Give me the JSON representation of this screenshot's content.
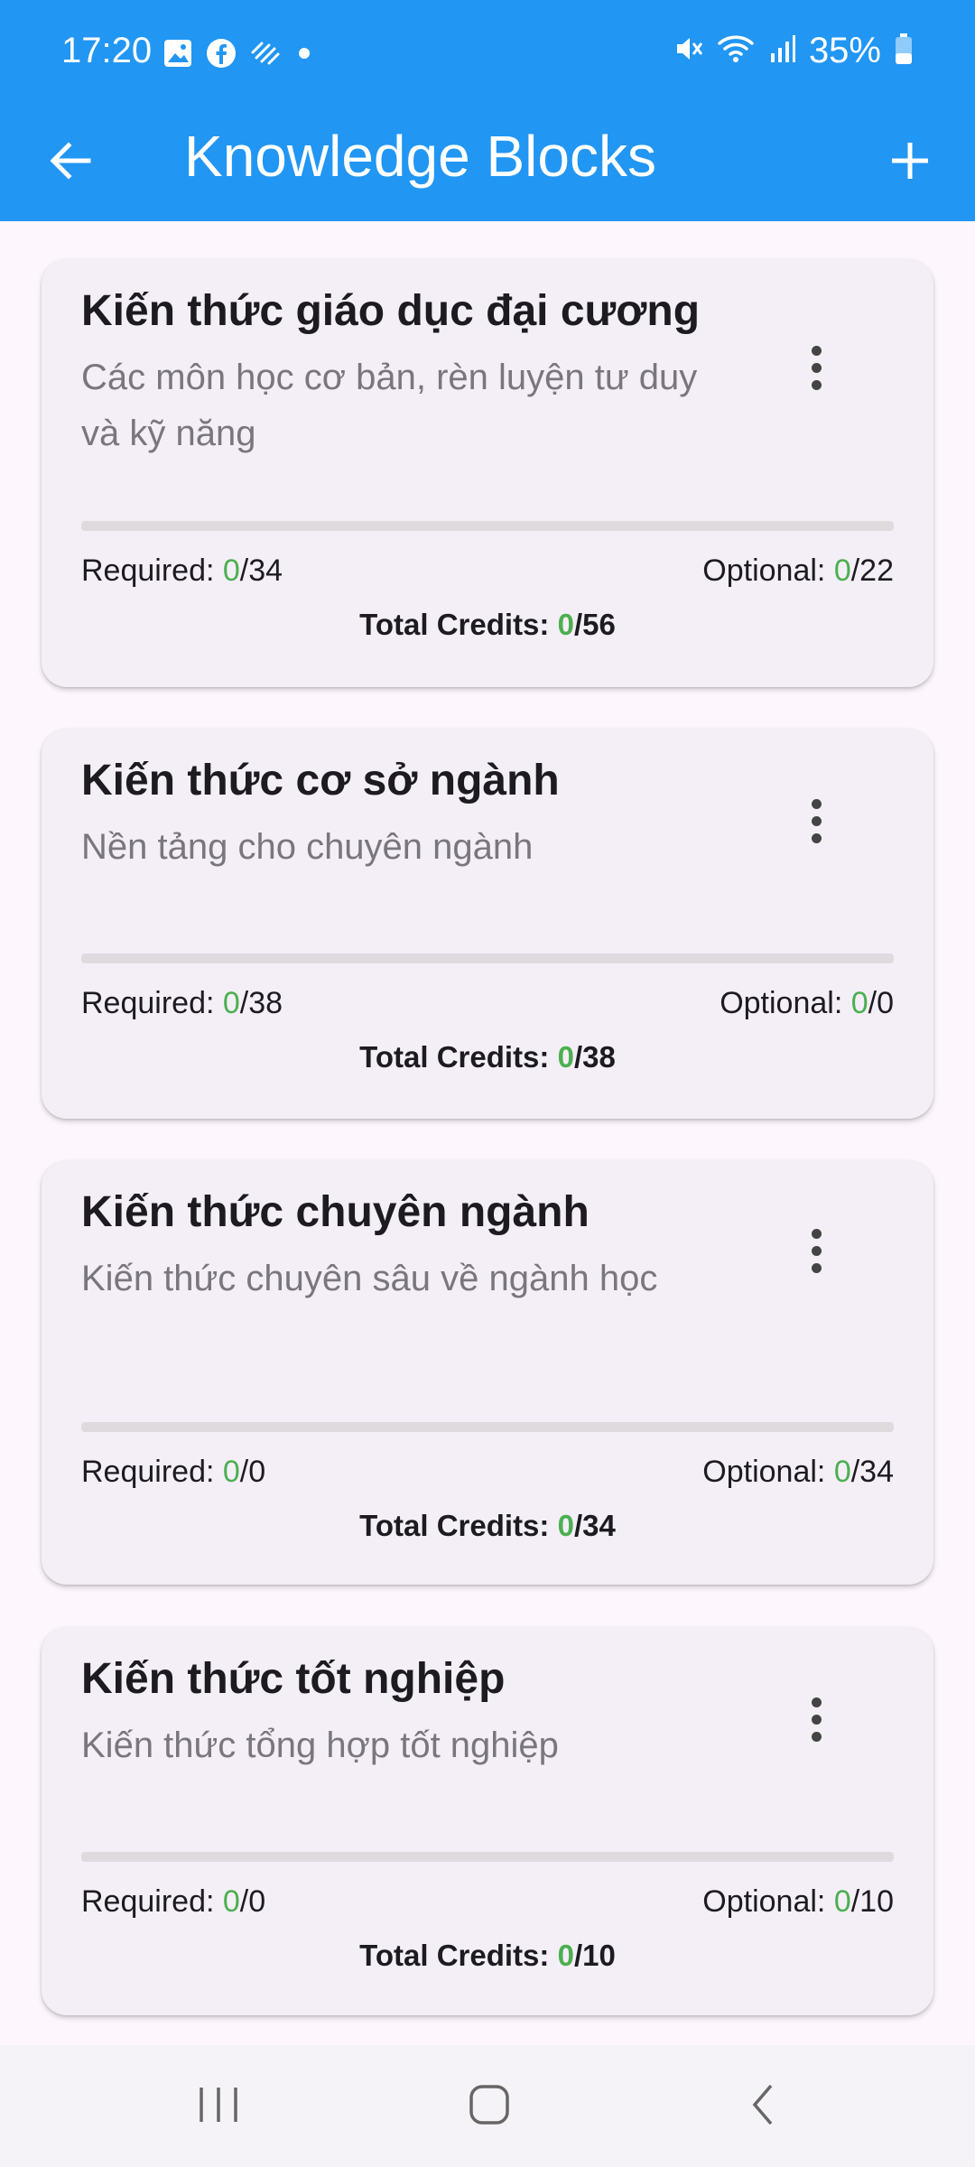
{
  "status_bar": {
    "time": "17:20",
    "battery": "35%",
    "icons": [
      "gallery-icon",
      "facebook-icon",
      "sync-icon",
      "dot-icon",
      "mute-icon",
      "wifi-icon",
      "signal-icon",
      "battery-icon"
    ]
  },
  "app_bar": {
    "title": "Knowledge Blocks",
    "back_icon": "arrow-back-icon",
    "add_icon": "add-icon",
    "color": "#2196f3"
  },
  "cards": [
    {
      "title": "Kiến thức giáo dục đại cương",
      "description": "Các môn học cơ bản, rèn luyện tư duy và kỹ năng",
      "progress": 0,
      "required_label": "Required: ",
      "required_done": "0",
      "required_total": "/34",
      "optional_label": "Optional: ",
      "optional_done": "0",
      "optional_total": "/22",
      "total_label": "Total Credits: ",
      "total_done": "0",
      "total_total": "/56"
    },
    {
      "title": "Kiến thức cơ sở ngành",
      "description": "Nền tảng cho chuyên ngành",
      "progress": 0,
      "required_label": "Required: ",
      "required_done": "0",
      "required_total": "/38",
      "optional_label": "Optional: ",
      "optional_done": "0",
      "optional_total": "/0",
      "total_label": "Total Credits: ",
      "total_done": "0",
      "total_total": "/38"
    },
    {
      "title": "Kiến thức chuyên ngành",
      "description": "Kiến thức chuyên sâu về ngành học",
      "progress": 0,
      "required_label": "Required: ",
      "required_done": "0",
      "required_total": "/0",
      "optional_label": "Optional: ",
      "optional_done": "0",
      "optional_total": "/34",
      "total_label": "Total Credits: ",
      "total_done": "0",
      "total_total": "/34"
    },
    {
      "title": "Kiến thức tốt nghiệp",
      "description": "Kiến thức tổng hợp tốt nghiệp",
      "progress": 0,
      "required_label": "Required: ",
      "required_done": "0",
      "required_total": "/0",
      "optional_label": "Optional: ",
      "optional_done": "0",
      "optional_total": "/10",
      "total_label": "Total Credits: ",
      "total_done": "0",
      "total_total": "/10"
    }
  ],
  "colors": {
    "accent_green": "#4caf50",
    "card_bg": "#f4eff7"
  },
  "nav_bar": {
    "icons": [
      "recent-apps-icon",
      "home-icon",
      "back-nav-icon"
    ]
  }
}
